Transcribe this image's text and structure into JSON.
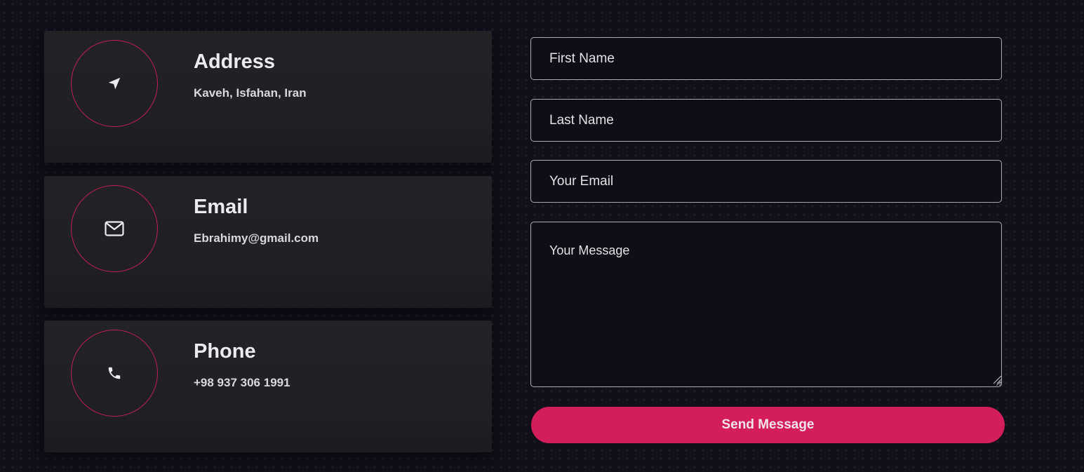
{
  "contact_cards": [
    {
      "icon": "location-arrow-icon",
      "title": "Address",
      "text": "Kaveh, Isfahan, Iran"
    },
    {
      "icon": "envelope-icon",
      "title": "Email",
      "text": "Ebrahimy@gmail.com"
    },
    {
      "icon": "phone-icon",
      "title": "Phone",
      "text": "+98 937 306 1991"
    }
  ],
  "form": {
    "first_name_placeholder": "First Name",
    "last_name_placeholder": "Last Name",
    "email_placeholder": "Your Email",
    "message_placeholder": "Your Message",
    "submit_label": "Send Message"
  },
  "colors": {
    "accent": "#d41d5b",
    "icon_ring": "#c0204f",
    "card_background": "#1f1f24",
    "page_background": "#100f1a"
  }
}
